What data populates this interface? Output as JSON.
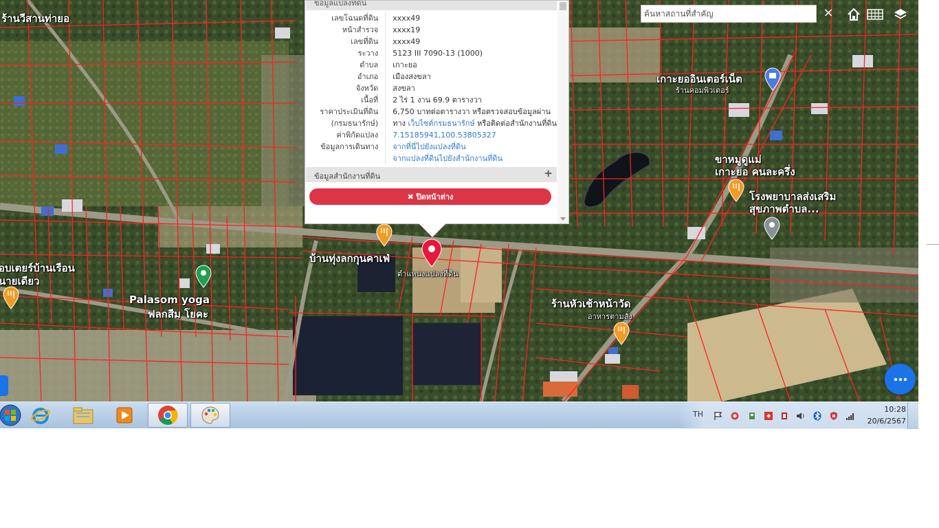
{
  "search": {
    "placeholder": "ค้นหาสถานที่สำคัญ",
    "clear_label": "×"
  },
  "popup": {
    "header": "ข้อมูลแปลงที่ดิน",
    "rows": [
      {
        "key": "เลขโฉนดที่ดิน",
        "value": "xxxx49"
      },
      {
        "key": "หน้าสำรวจ",
        "value": "xxxx19"
      },
      {
        "key": "เลขที่ดิน",
        "value": "xxxx49"
      },
      {
        "key": "ระวาง",
        "value": "5123 III 7090-13 (1000)"
      },
      {
        "key": "ตำบล",
        "value": "เกาะยอ"
      },
      {
        "key": "อำเภอ",
        "value": "เมืองสงขลา"
      },
      {
        "key": "จังหวัด",
        "value": "สงขลา"
      },
      {
        "key": "เนื้อที่",
        "value": "2 ไร่ 1 งาน 69.9 ตารางวา"
      },
      {
        "key": "ราคาประเมินที่ดิน",
        "value": "6,750 บาทต่อตารางวา หรือตรวจสอบข้อมูลผ่าน"
      },
      {
        "key": "(กรมธนารักษ์)",
        "value_prefix": "ทาง ",
        "link": "เว็บไซต์กรมธนารักษ์",
        "value_suffix": " หรือติดต่อสำนักงานที่ดิน"
      },
      {
        "key": "ค่าพิกัดแปลง",
        "link": "7.15185941,100.53805327"
      },
      {
        "key": "ข้อมูลการเดินทาง",
        "link": "จากที่นี่ไปยังแปลงที่ดิน"
      },
      {
        "key": "",
        "link": "จากแปลงที่ดินไปยังสำนักงานที่ดิน"
      }
    ],
    "office_section": "ข้อมูลสำนักงานที่ดิน",
    "office_expand": "+",
    "close_button": "✖ ปิดหน้าต่าง"
  },
  "map": {
    "labels": {
      "top_left": "ร้านวีสานท่ายอ",
      "koyo_internet": "เกาะยออินเตอร์เน็ต",
      "computer_shop": "ร้านคอมพิวเตอร์",
      "khanom": "ขาหมูดูแม่",
      "khanom2": "เกาะยอ คนละครึ่ง",
      "hospital": "โรงพยาบาลส่งเสริม",
      "hospital2": "สุขภาพตำบล...",
      "cafe": "บ้านทุ่งลกกุนคาเฟ่",
      "parcel_pos": "ตำแหน่งแปลงที่ดิน",
      "left_shop": "อบเตยร์บ้านเรือน",
      "left_shop2": "นายเดียว",
      "palasom": "Palasom yoga",
      "palasom2": "ฟลกสีม โยคะ",
      "hua_chang": "ร้านหัวเช้าหน้าวัด",
      "food": "อาหารตามสั่ง"
    }
  },
  "taskbar": {
    "lang": "TH",
    "time": "10:28",
    "date": "20/6/2567",
    "apps": [
      "start-orb",
      "internet-explorer",
      "file-explorer",
      "media-player",
      "chrome",
      "paint"
    ]
  },
  "colors": {
    "accent": "#1a73e8",
    "close_red": "#dc3545",
    "parcel_line": "#ff2020",
    "pin_red": "#e8183a"
  }
}
